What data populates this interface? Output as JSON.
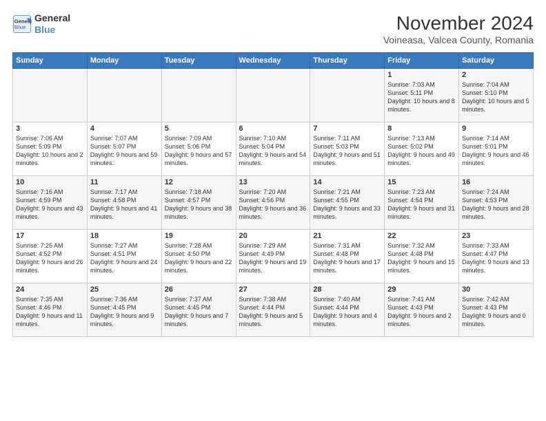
{
  "header": {
    "logo_line1": "General",
    "logo_line2": "Blue",
    "title": "November 2024",
    "subtitle": "Voineasa, Valcea County, Romania"
  },
  "days_of_week": [
    "Sunday",
    "Monday",
    "Tuesday",
    "Wednesday",
    "Thursday",
    "Friday",
    "Saturday"
  ],
  "weeks": [
    [
      {
        "day": "",
        "info": ""
      },
      {
        "day": "",
        "info": ""
      },
      {
        "day": "",
        "info": ""
      },
      {
        "day": "",
        "info": ""
      },
      {
        "day": "",
        "info": ""
      },
      {
        "day": "1",
        "info": "Sunrise: 7:03 AM\nSunset: 5:11 PM\nDaylight: 10 hours and 8 minutes."
      },
      {
        "day": "2",
        "info": "Sunrise: 7:04 AM\nSunset: 5:10 PM\nDaylight: 10 hours and 5 minutes."
      }
    ],
    [
      {
        "day": "3",
        "info": "Sunrise: 7:06 AM\nSunset: 5:09 PM\nDaylight: 10 hours and 2 minutes."
      },
      {
        "day": "4",
        "info": "Sunrise: 7:07 AM\nSunset: 5:07 PM\nDaylight: 9 hours and 59 minutes."
      },
      {
        "day": "5",
        "info": "Sunrise: 7:09 AM\nSunset: 5:06 PM\nDaylight: 9 hours and 57 minutes."
      },
      {
        "day": "6",
        "info": "Sunrise: 7:10 AM\nSunset: 5:04 PM\nDaylight: 9 hours and 54 minutes."
      },
      {
        "day": "7",
        "info": "Sunrise: 7:11 AM\nSunset: 5:03 PM\nDaylight: 9 hours and 51 minutes."
      },
      {
        "day": "8",
        "info": "Sunrise: 7:13 AM\nSunset: 5:02 PM\nDaylight: 9 hours and 49 minutes."
      },
      {
        "day": "9",
        "info": "Sunrise: 7:14 AM\nSunset: 5:01 PM\nDaylight: 9 hours and 46 minutes."
      }
    ],
    [
      {
        "day": "10",
        "info": "Sunrise: 7:16 AM\nSunset: 4:59 PM\nDaylight: 9 hours and 43 minutes."
      },
      {
        "day": "11",
        "info": "Sunrise: 7:17 AM\nSunset: 4:58 PM\nDaylight: 9 hours and 41 minutes."
      },
      {
        "day": "12",
        "info": "Sunrise: 7:18 AM\nSunset: 4:57 PM\nDaylight: 9 hours and 38 minutes."
      },
      {
        "day": "13",
        "info": "Sunrise: 7:20 AM\nSunset: 4:56 PM\nDaylight: 9 hours and 36 minutes."
      },
      {
        "day": "14",
        "info": "Sunrise: 7:21 AM\nSunset: 4:55 PM\nDaylight: 9 hours and 33 minutes."
      },
      {
        "day": "15",
        "info": "Sunrise: 7:23 AM\nSunset: 4:54 PM\nDaylight: 9 hours and 31 minutes."
      },
      {
        "day": "16",
        "info": "Sunrise: 7:24 AM\nSunset: 4:53 PM\nDaylight: 9 hours and 28 minutes."
      }
    ],
    [
      {
        "day": "17",
        "info": "Sunrise: 7:25 AM\nSunset: 4:52 PM\nDaylight: 9 hours and 26 minutes."
      },
      {
        "day": "18",
        "info": "Sunrise: 7:27 AM\nSunset: 4:51 PM\nDaylight: 9 hours and 24 minutes."
      },
      {
        "day": "19",
        "info": "Sunrise: 7:28 AM\nSunset: 4:50 PM\nDaylight: 9 hours and 22 minutes."
      },
      {
        "day": "20",
        "info": "Sunrise: 7:29 AM\nSunset: 4:49 PM\nDaylight: 9 hours and 19 minutes."
      },
      {
        "day": "21",
        "info": "Sunrise: 7:31 AM\nSunset: 4:48 PM\nDaylight: 9 hours and 17 minutes."
      },
      {
        "day": "22",
        "info": "Sunrise: 7:32 AM\nSunset: 4:48 PM\nDaylight: 9 hours and 15 minutes."
      },
      {
        "day": "23",
        "info": "Sunrise: 7:33 AM\nSunset: 4:47 PM\nDaylight: 9 hours and 13 minutes."
      }
    ],
    [
      {
        "day": "24",
        "info": "Sunrise: 7:35 AM\nSunset: 4:46 PM\nDaylight: 9 hours and 11 minutes."
      },
      {
        "day": "25",
        "info": "Sunrise: 7:36 AM\nSunset: 4:45 PM\nDaylight: 9 hours and 9 minutes."
      },
      {
        "day": "26",
        "info": "Sunrise: 7:37 AM\nSunset: 4:45 PM\nDaylight: 9 hours and 7 minutes."
      },
      {
        "day": "27",
        "info": "Sunrise: 7:38 AM\nSunset: 4:44 PM\nDaylight: 9 hours and 5 minutes."
      },
      {
        "day": "28",
        "info": "Sunrise: 7:40 AM\nSunset: 4:44 PM\nDaylight: 9 hours and 4 minutes."
      },
      {
        "day": "29",
        "info": "Sunrise: 7:41 AM\nSunset: 4:43 PM\nDaylight: 9 hours and 2 minutes."
      },
      {
        "day": "30",
        "info": "Sunrise: 7:42 AM\nSunset: 4:43 PM\nDaylight: 9 hours and 0 minutes."
      }
    ]
  ]
}
